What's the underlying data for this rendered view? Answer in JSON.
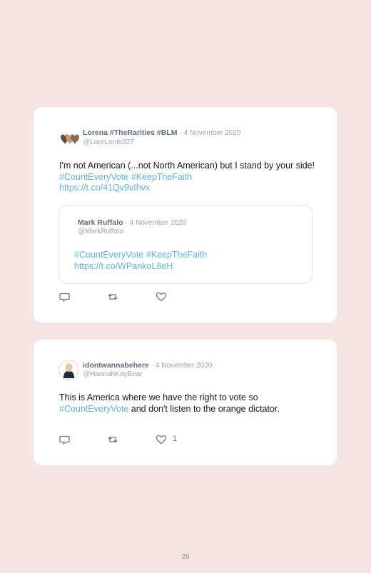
{
  "tweets": [
    {
      "display_name": "Lorena #TheRarities #BLM",
      "separator": "·",
      "date": "4 November 2020",
      "handle": "@LoreLamb327",
      "text_plain": "I'm not American (...not North American) but I stand by your side!",
      "hashtag_1": "#CountEveryVote",
      "hashtag_2": "#KeepTheFaith",
      "link": "https://t.co/41Qv9vIhvx",
      "quoted": {
        "display_name": "Mark Ruffalo",
        "separator": "·",
        "date": "4 November 2020",
        "handle": "@MarkRuffalo",
        "hashtag_1": "#CountEveryVote",
        "hashtag_2": "#KeepTheFaith",
        "link": "https://t.co/WPankoL8eH"
      }
    },
    {
      "display_name": "idontwannabehere",
      "separator": "·",
      "date": "4 November 2020",
      "handle": "@HannahKayBear",
      "text_plain_1": "This is America where we have the right to vote so",
      "hashtag_1": "#CountEveryVote",
      "text_plain_2": "and don't listen to the orange dictator.",
      "like_count": "1"
    }
  ],
  "icons": {
    "reply": "reply-icon",
    "retweet": "retweet-icon",
    "like": "heart-icon"
  },
  "colors": {
    "background": "#f6e4e3",
    "card": "#ffffff",
    "name": "#5b6d82",
    "meta": "#9aa3ad",
    "link": "#5db3e3"
  },
  "page_number": "26"
}
